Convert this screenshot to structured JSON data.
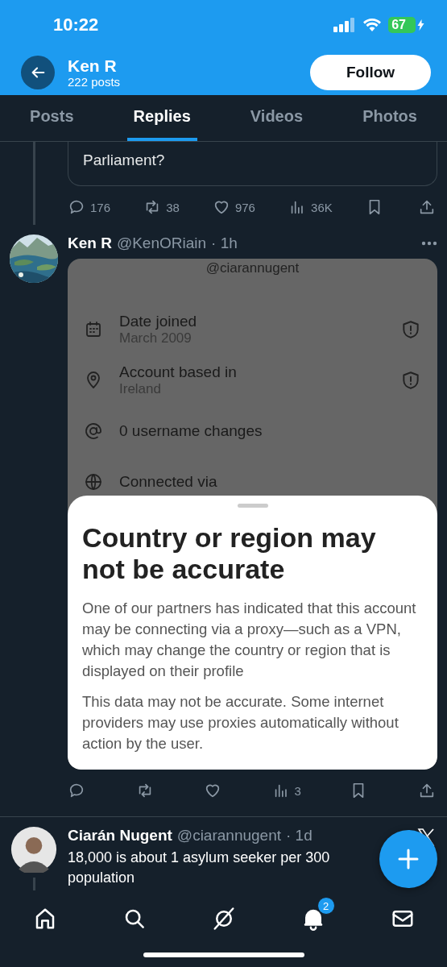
{
  "status_bar": {
    "time": "10:22",
    "battery": "67"
  },
  "header": {
    "name": "Ken R",
    "posts": "222 posts",
    "follow_button": "Follow"
  },
  "tabs": [
    {
      "label": "Posts",
      "selected": false
    },
    {
      "label": "Replies",
      "selected": true
    },
    {
      "label": "Videos",
      "selected": false
    },
    {
      "label": "Photos",
      "selected": false
    }
  ],
  "quoted_post": {
    "text": "Parliament?",
    "actions": {
      "replies": "176",
      "reposts": "38",
      "likes": "976",
      "views": "36K"
    }
  },
  "post": {
    "name": "Ken R",
    "handle": "@KenORiain",
    "time": "· 1h",
    "embedded_screenshot": {
      "handle": "@ciarannugent",
      "rows": [
        {
          "title": "Date joined",
          "value": "March 2009",
          "warning": true
        },
        {
          "title": "Account based in",
          "value": "Ireland",
          "warning": true
        },
        {
          "title": "0 username changes",
          "warning": false
        },
        {
          "title": "Connected via",
          "warning": false
        }
      ],
      "sheet": {
        "title": "Country or region may not be accurate",
        "paragraphs": [
          "One of our partners has indicated that this account may be connecting via a proxy—such as a VPN, which may change the country or region that is displayed on their profile",
          "This data may not be accurate. Some internet providers may use proxies automatically without action by the user."
        ]
      }
    },
    "actions": {
      "views": "3"
    }
  },
  "next_post": {
    "name": "Ciarán Nugent",
    "handle": "@ciarannugent",
    "time": "· 1d",
    "text": "18,000 is about 1 asylum seeker per 300\npopulation"
  },
  "bottom_nav": {
    "notification_badge": "2"
  }
}
